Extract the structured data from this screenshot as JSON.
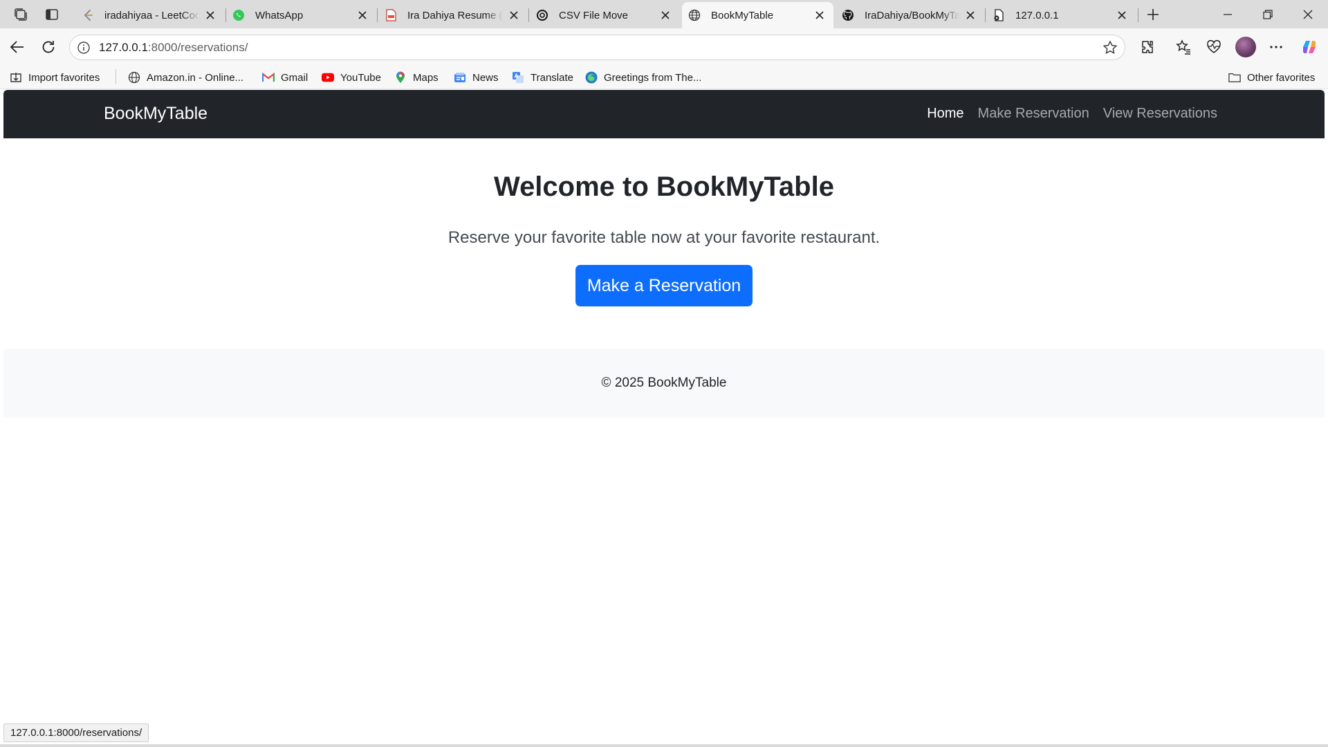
{
  "browser": {
    "tabs": [
      {
        "title": "iradahiyaa - LeetCode",
        "icon": "leetcode-favicon",
        "active": false
      },
      {
        "title": "WhatsApp",
        "icon": "whatsapp-favicon",
        "active": false
      },
      {
        "title": "Ira Dahiya Resume (1)",
        "icon": "pdf-favicon",
        "active": false
      },
      {
        "title": "CSV File Move",
        "icon": "chatgpt-favicon",
        "active": false
      },
      {
        "title": "BookMyTable",
        "icon": "globe-favicon",
        "active": true
      },
      {
        "title": "IraDahiya/BookMyTable",
        "icon": "github-favicon",
        "active": false
      },
      {
        "title": "127.0.0.1",
        "icon": "page-error-favicon",
        "active": false
      }
    ],
    "address": {
      "host": "127.0.0.1",
      "rest": ":8000/reservations/"
    },
    "favorites": [
      {
        "label": "Import favorites",
        "icon": "import-icon"
      },
      {
        "label": "Amazon.in - Online...",
        "icon": "globe-icon"
      },
      {
        "label": "Gmail",
        "icon": "gmail-icon"
      },
      {
        "label": "YouTube",
        "icon": "youtube-icon"
      },
      {
        "label": "Maps",
        "icon": "maps-icon"
      },
      {
        "label": "News",
        "icon": "news-icon"
      },
      {
        "label": "Translate",
        "icon": "translate-icon"
      },
      {
        "label": "Greetings from The...",
        "icon": "edge-icon"
      }
    ],
    "other_favorites": "Other favorites",
    "status_url": "127.0.0.1:8000/reservations/"
  },
  "site": {
    "brand": "BookMyTable",
    "nav": [
      {
        "label": "Home",
        "active": true
      },
      {
        "label": "Make Reservation",
        "active": false
      },
      {
        "label": "View Reservations",
        "active": false
      }
    ],
    "hero": {
      "title": "Welcome to BookMyTable",
      "lead": "Reserve your favorite table now at your favorite restaurant.",
      "cta": "Make a Reservation"
    },
    "footer": "© 2025 BookMyTable"
  },
  "colors": {
    "navbar_bg": "#212529",
    "primary_button": "#0d6efd",
    "footer_bg": "#f8f9fa"
  }
}
